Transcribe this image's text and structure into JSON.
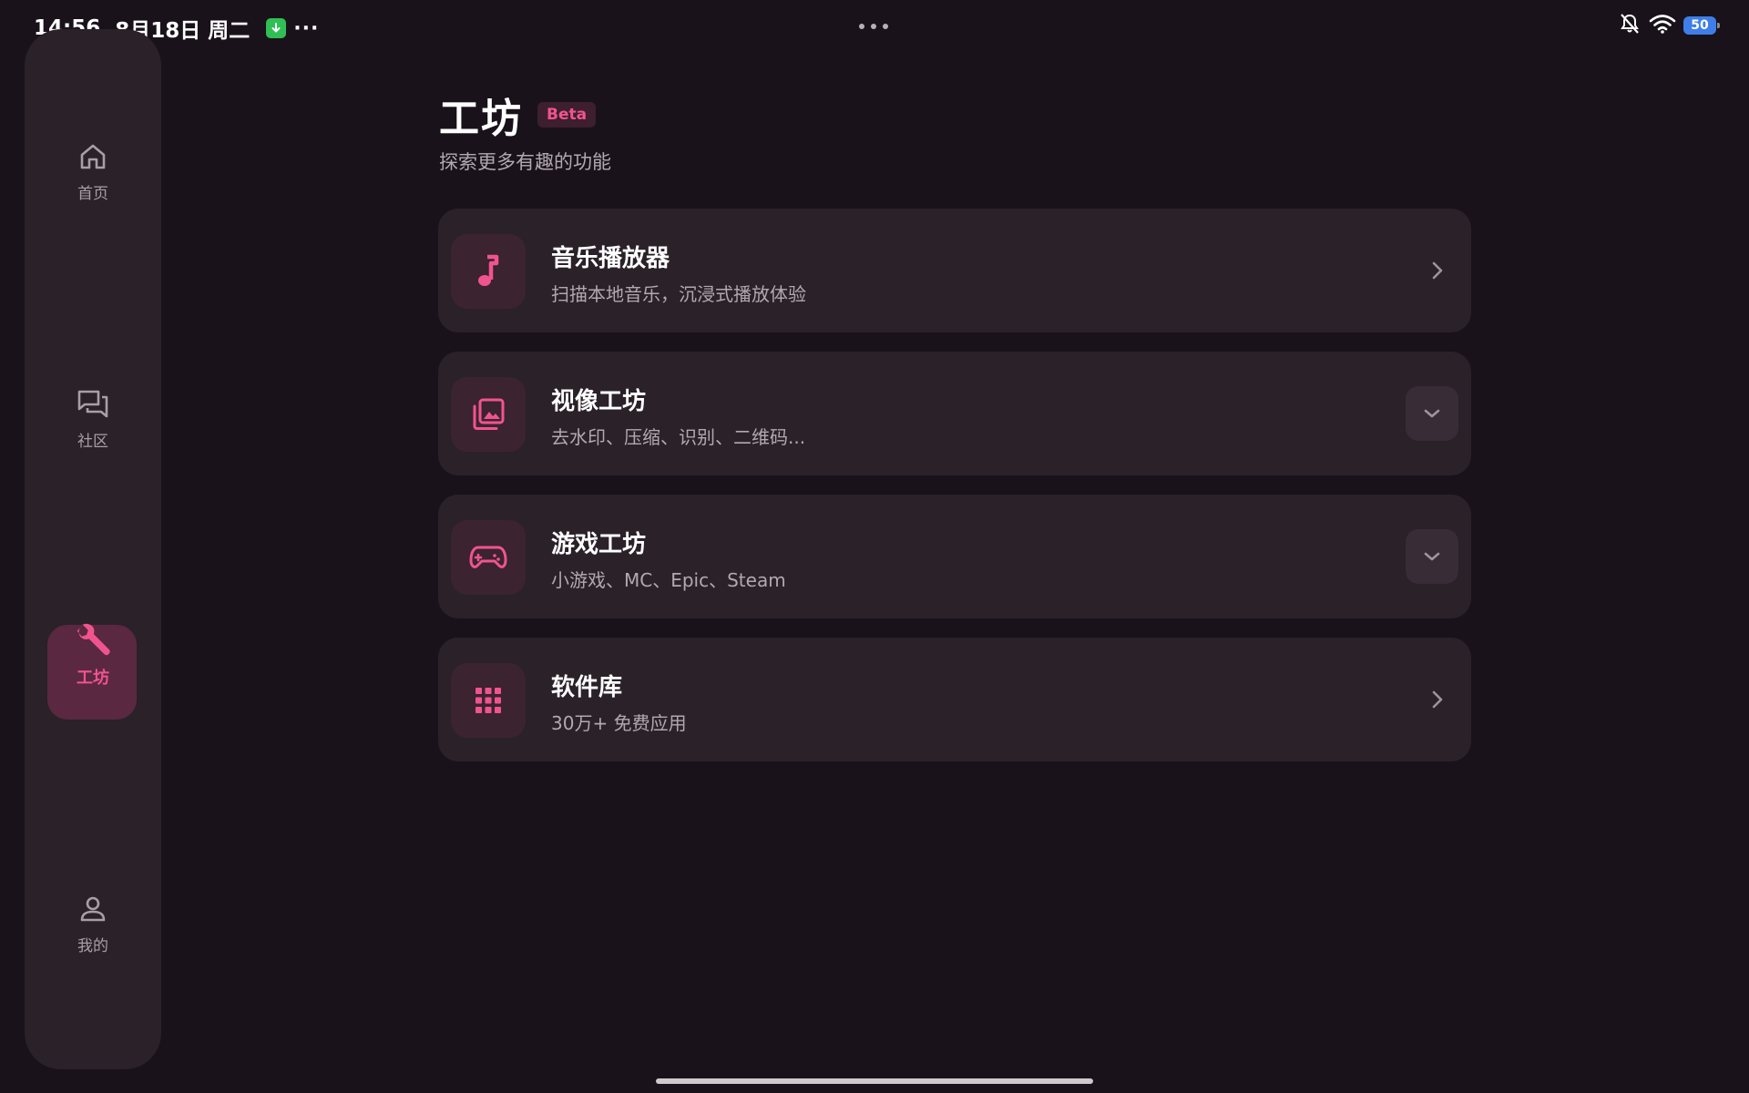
{
  "status_bar": {
    "time": "14:56",
    "date": "8月18日 周二",
    "more": "···",
    "battery": "50"
  },
  "sidebar": {
    "items": [
      {
        "label": "首页",
        "icon": "home-icon"
      },
      {
        "label": "社区",
        "icon": "chat-icon"
      },
      {
        "label": "工坊",
        "icon": "wrench-icon",
        "active": true
      },
      {
        "label": "我的",
        "icon": "person-icon"
      }
    ]
  },
  "header": {
    "title": "工坊",
    "badge": "Beta",
    "subtitle": "探索更多有趣的功能"
  },
  "cards": [
    {
      "title": "音乐播放器",
      "desc": "扫描本地音乐，沉浸式播放体验",
      "icon": "music-note-icon",
      "action": "chevron-right"
    },
    {
      "title": "视像工坊",
      "desc": "去水印、压缩、识别、二维码...",
      "icon": "image-gallery-icon",
      "action": "expand"
    },
    {
      "title": "游戏工坊",
      "desc": "小游戏、MC、Epic、Steam",
      "icon": "gamepad-icon",
      "action": "expand"
    },
    {
      "title": "软件库",
      "desc": "30万+ 免费应用",
      "icon": "apps-grid-icon",
      "action": "chevron-right"
    }
  ],
  "colors": {
    "background": "#19121a",
    "surface": "#2a2129",
    "accent": "#f0548f",
    "text_secondary": "#b3a8b0"
  }
}
